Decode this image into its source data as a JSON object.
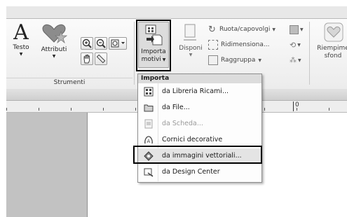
{
  "ribbon": {
    "groups": {
      "strumenti": "Strumenti"
    },
    "buttons": {
      "testo": "Testo",
      "attributi": "Attributi",
      "importa_line1": "Importa",
      "importa_line2": "motivi",
      "disponi": "Disponi",
      "ruota": "Ruota/capovolgi",
      "ridimensiona": "Ridimensiona...",
      "raggruppa": "Raggruppa",
      "riempimento_line1": "Riempime",
      "riempimento_line2": "sfond"
    }
  },
  "ruler": {
    "zero_label": "0"
  },
  "menu": {
    "header": "Importa",
    "items": [
      {
        "label": "da Libreria Ricami...",
        "enabled": true
      },
      {
        "label": "da File...",
        "enabled": true
      },
      {
        "label": "da Scheda...",
        "enabled": false
      },
      {
        "label": "Cornici decorative",
        "enabled": true
      },
      {
        "label": "da immagini vettoriali...",
        "enabled": true,
        "highlighted": true
      },
      {
        "label": "da Design Center",
        "enabled": true
      }
    ]
  },
  "colors": {
    "highlight_border": "#000000",
    "disabled_text": "#9a9a9a"
  }
}
